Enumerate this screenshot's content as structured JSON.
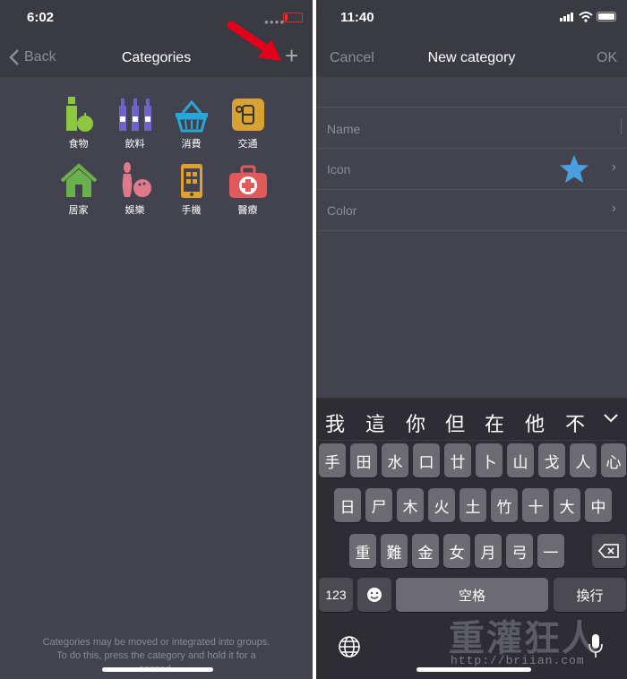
{
  "left": {
    "status_time": "6:02",
    "back_label": "Back",
    "title": "Categories",
    "add_label": "+",
    "categories": [
      {
        "label": "食物",
        "icon": "food-icon",
        "color": "#8dc63f"
      },
      {
        "label": "飲料",
        "icon": "drinks-icon",
        "color": "#6f63c9"
      },
      {
        "label": "消費",
        "icon": "shopping-basket-icon",
        "color": "#27a7d9"
      },
      {
        "label": "交通",
        "icon": "transport-icon",
        "color": "#d9a032"
      },
      {
        "label": "居家",
        "icon": "house-icon",
        "color": "#6ab04c"
      },
      {
        "label": "娛樂",
        "icon": "bowling-icon",
        "color": "#e07a8a"
      },
      {
        "label": "手機",
        "icon": "phone-icon",
        "color": "#e0a030"
      },
      {
        "label": "醫療",
        "icon": "medical-kit-icon",
        "color": "#e05a5a"
      }
    ],
    "footer_line1": "Categories may be moved or integrated into groups.",
    "footer_line2": "To do this, press the category and hold it for a",
    "footer_line3": "second."
  },
  "right": {
    "status_time": "11:40",
    "cancel_label": "Cancel",
    "title": "New category",
    "ok_label": "OK",
    "name_label": "Name",
    "icon_label": "Icon",
    "color_label": "Color",
    "star_color": "#4a9fe0",
    "keyboard": {
      "candidates": [
        "我",
        "這",
        "你",
        "但",
        "在",
        "他",
        "不"
      ],
      "row1": [
        "手",
        "田",
        "水",
        "口",
        "廿",
        "卜",
        "山",
        "戈",
        "人",
        "心"
      ],
      "row2": [
        "日",
        "尸",
        "木",
        "火",
        "土",
        "竹",
        "十",
        "大",
        "中"
      ],
      "row3": [
        "重",
        "難",
        "金",
        "女",
        "月",
        "弓",
        "一"
      ],
      "numbers_label": "123",
      "space_label": "空格",
      "return_label": "換行"
    }
  },
  "watermark": "重灌狂人",
  "watermark_url": "http://briian.com",
  "colors": {
    "background": "#43434f",
    "bar": "#3a3a43",
    "arrow": "#e3001b"
  }
}
